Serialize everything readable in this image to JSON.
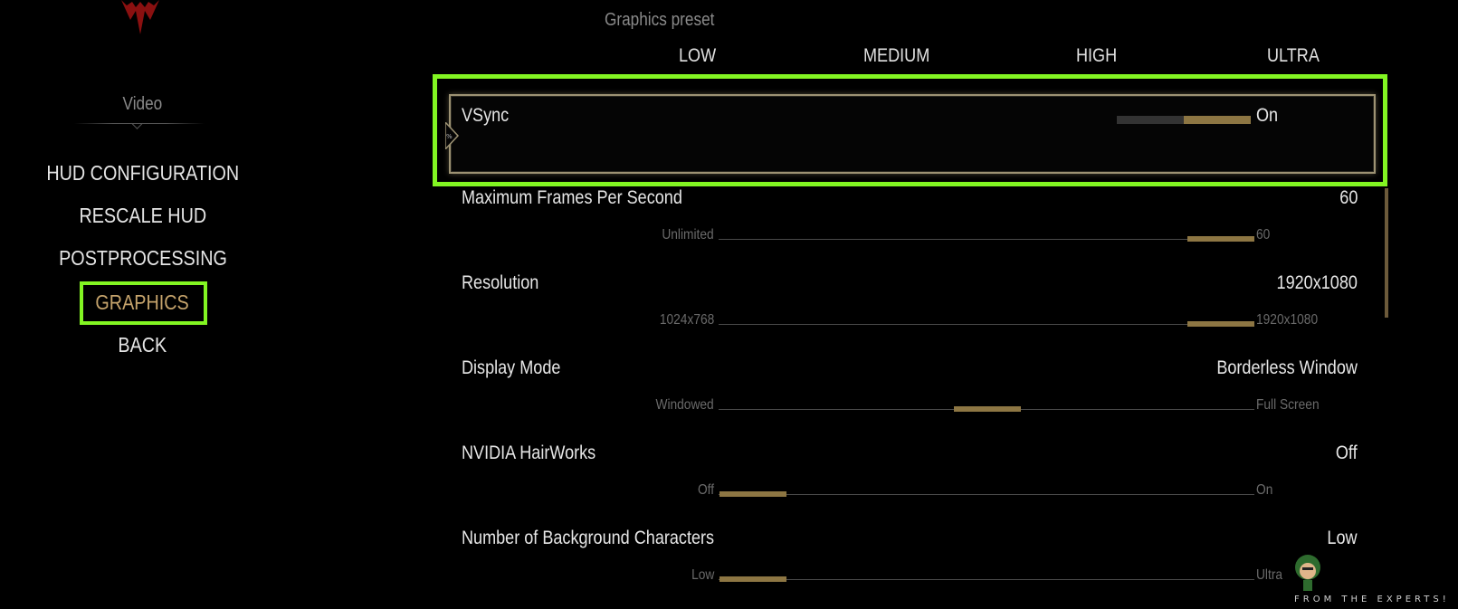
{
  "menu": {
    "section_title": "Video",
    "items": [
      {
        "label": "HUD CONFIGURATION"
      },
      {
        "label": "RESCALE HUD"
      },
      {
        "label": "POSTPROCESSING"
      },
      {
        "label": "GRAPHICS"
      },
      {
        "label": "BACK"
      }
    ],
    "active": "GRAPHICS"
  },
  "preset": {
    "title": "Graphics preset",
    "options": [
      "LOW",
      "MEDIUM",
      "HIGH",
      "ULTRA"
    ]
  },
  "options": {
    "vsync": {
      "label": "VSync",
      "value": "On",
      "level": 1.0
    },
    "max_fps": {
      "label": "Maximum Frames Per Second",
      "value": "60",
      "min": "Unlimited",
      "max": "60",
      "level": 1.0
    },
    "resolution": {
      "label": "Resolution",
      "value": "1920x1080",
      "min": "1024x768",
      "max": "1920x1080",
      "level": 1.0
    },
    "display_mode": {
      "label": "Display Mode",
      "value": "Borderless Window",
      "min": "Windowed",
      "max": "Full Screen",
      "level": 0.5
    },
    "hairworks": {
      "label": "NVIDIA HairWorks",
      "value": "Off",
      "min": "Off",
      "max": "On",
      "level": 0.0
    },
    "bg_characters": {
      "label": "Number of Background Characters",
      "value": "Low",
      "min": "Low",
      "max": "Ultra",
      "level": 0.0
    }
  },
  "watermark": {
    "text": "FROM THE EXPERTS!"
  },
  "colors": {
    "accent": "#c6a46c",
    "highlight": "#82f522",
    "slider": "#8d7643"
  }
}
